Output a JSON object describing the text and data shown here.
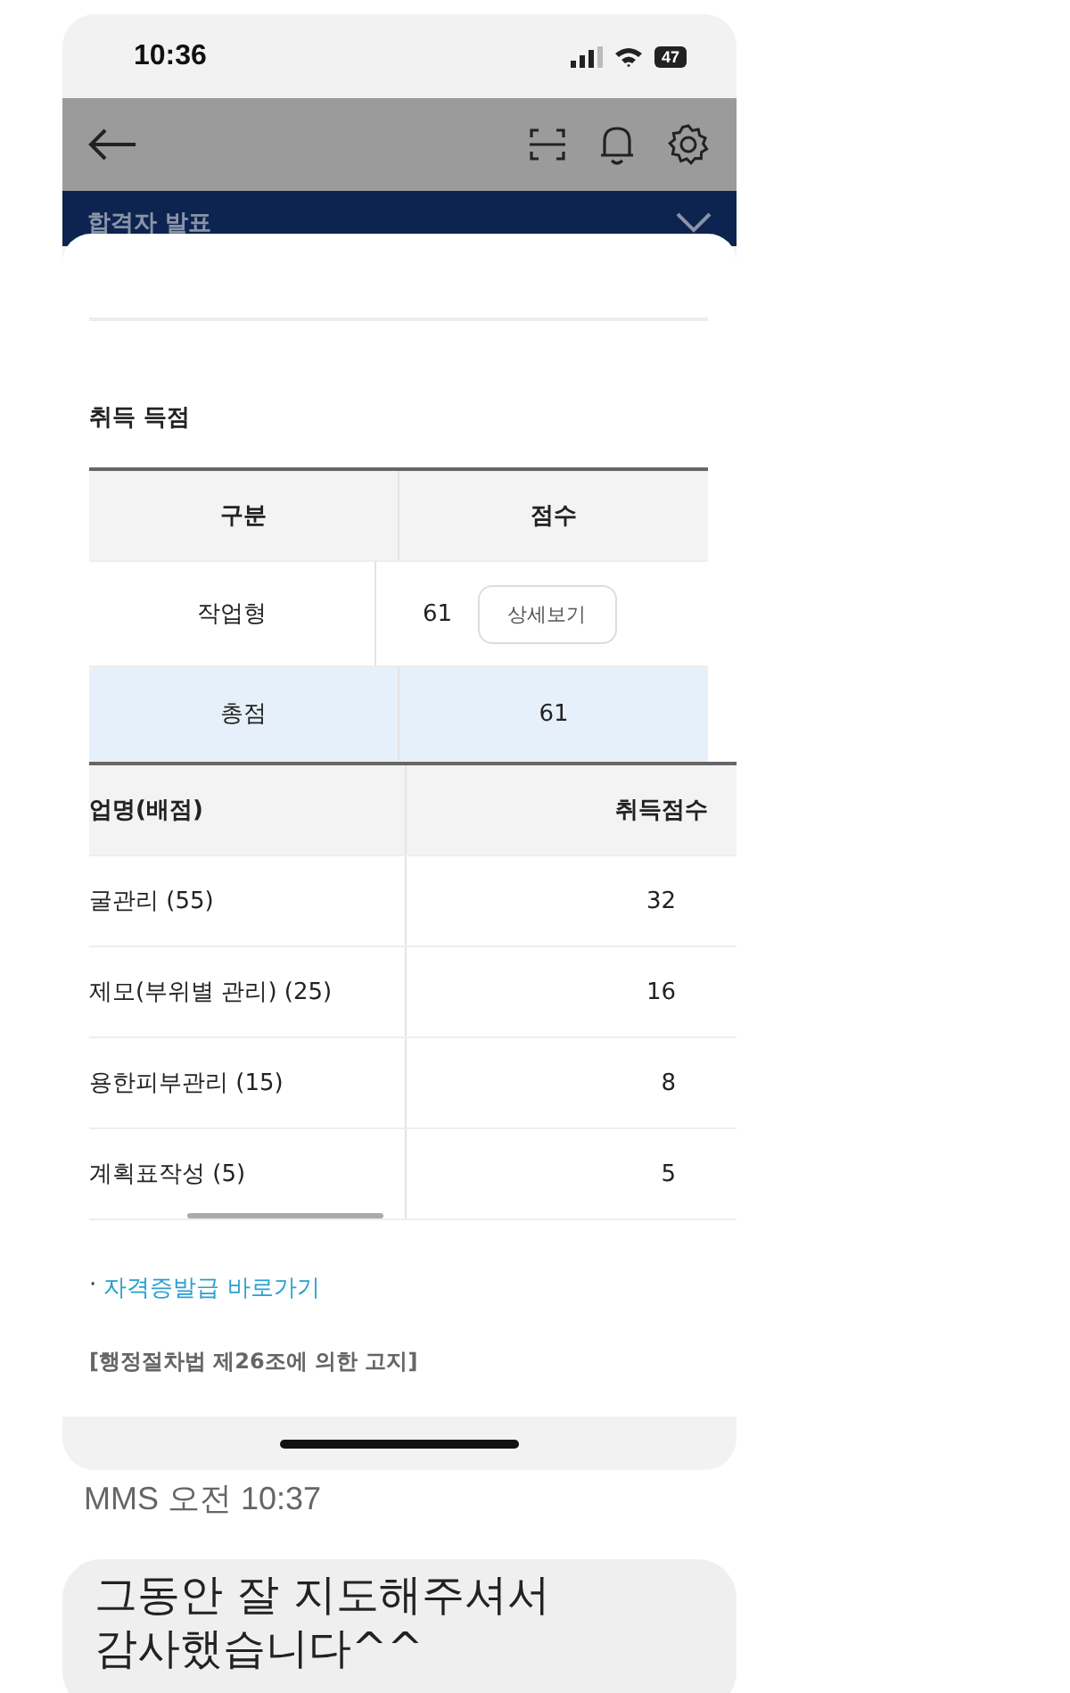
{
  "status_bar": {
    "time": "10:36",
    "battery": "47"
  },
  "banner": {
    "title": "합격자 발표"
  },
  "section_title": "취득 득점",
  "score_table": {
    "columns": [
      "구분",
      "점수"
    ],
    "rows": [
      {
        "label": "작업형",
        "score": "61",
        "button": "상세보기",
        "highlighted": false
      },
      {
        "label": "총점",
        "score": "61",
        "highlighted": true
      }
    ]
  },
  "detail_table": {
    "columns": [
      "업명(배점)",
      "취득점수"
    ],
    "rows": [
      {
        "name": "굴관리 (55)",
        "score": "32"
      },
      {
        "name": "제모(부위별 관리) (25)",
        "score": "16"
      },
      {
        "name": "용한피부관리 (15)",
        "score": "8"
      },
      {
        "name": "계획표작성 (5)",
        "score": "5"
      }
    ]
  },
  "link": {
    "bullet": "·",
    "text": "자격증발급 바로가기"
  },
  "notice": "[행정절차법 제26조에 의한 고지]",
  "message_meta": "MMS 오전 10:37",
  "message": "그동안 잘 지도해주셔서\n감사했습니다^^"
}
